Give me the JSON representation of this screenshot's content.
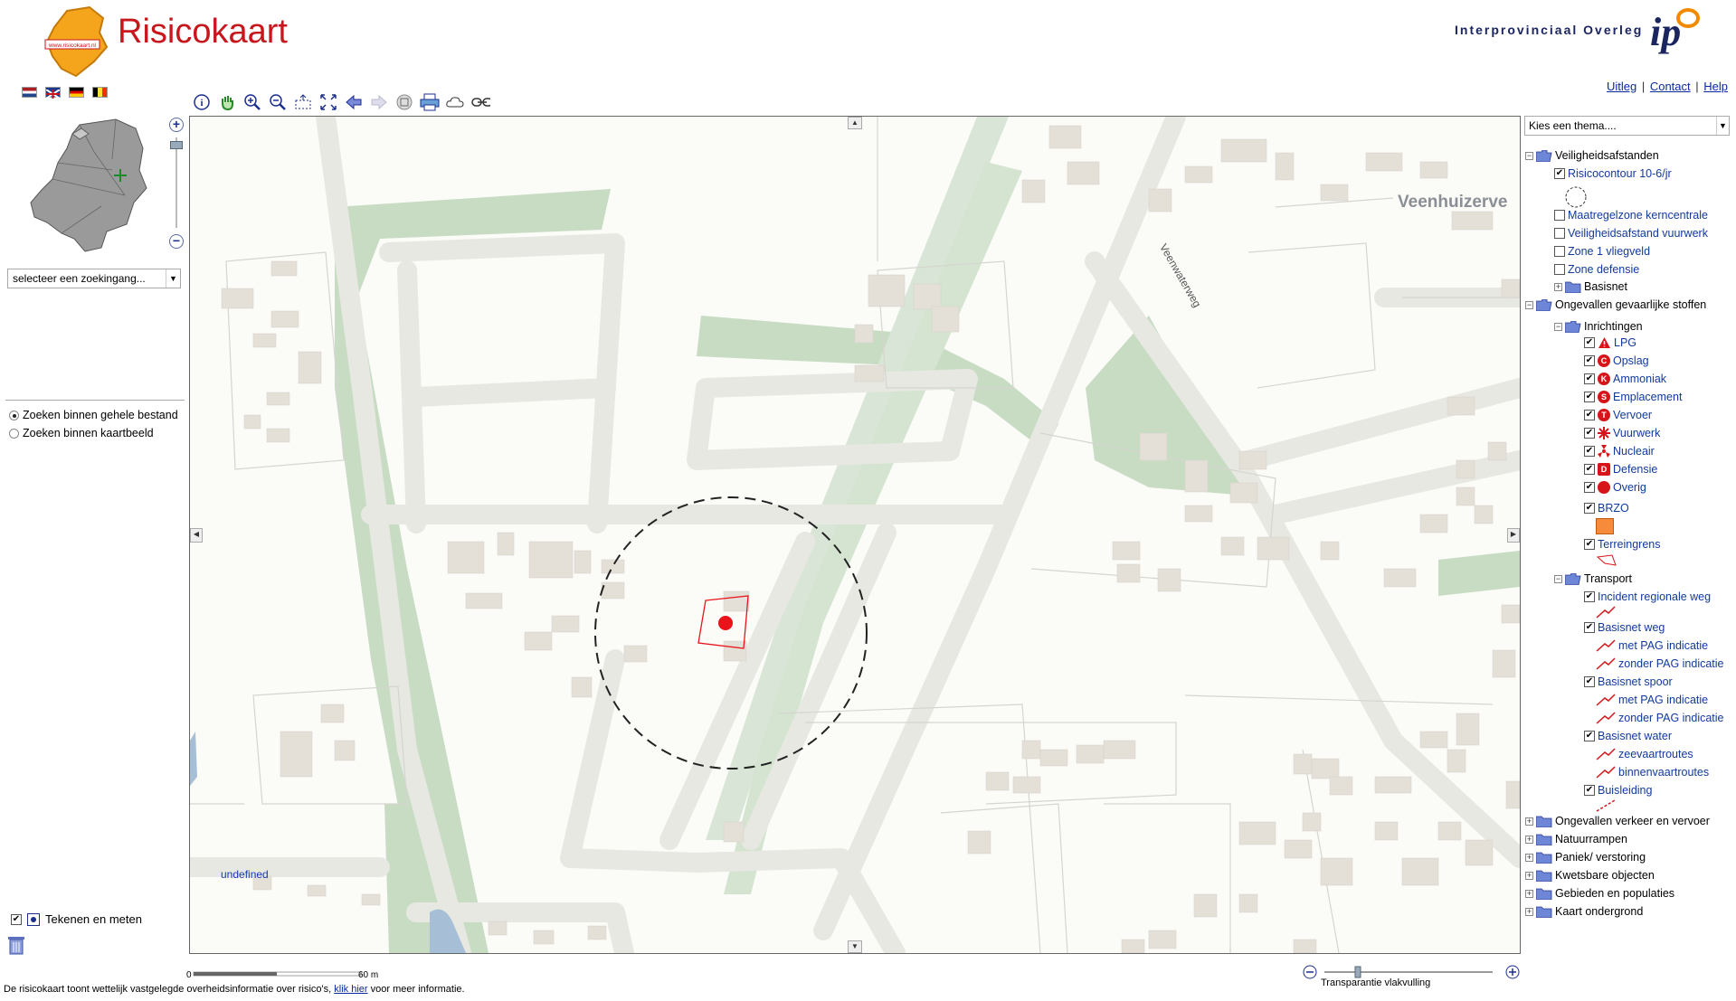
{
  "header": {
    "site_title": "Risicokaart",
    "logo_url_text": "www.risicokaart.nl",
    "partner_name": "Interprovinciaal Overleg",
    "partner_logo_text": "ip",
    "links": [
      {
        "label": "Uitleg"
      },
      {
        "label": "Contact"
      },
      {
        "label": "Help"
      }
    ]
  },
  "left_panel": {
    "search_select": "selecteer  een zoekingang...",
    "radio_options": [
      {
        "label": "Zoeken binnen gehele bestand",
        "selected": true
      },
      {
        "label": "Zoeken binnen kaartbeeld",
        "selected": false
      }
    ],
    "draw_measure_label": "Tekenen en meten"
  },
  "map": {
    "street_label": "Veenwaterweg",
    "place_label": "Veenhuizerve",
    "coord_readout": "undefined",
    "scale_start": "0",
    "scale_end": "60 m"
  },
  "transparency_label": "Transparantie vlakvulling",
  "footer": {
    "text_before": "De risicokaart toont wettelijk vastgelegde overheidsinformatie over risico's,",
    "link": "klik hier",
    "text_after": "voor meer informatie."
  },
  "right_panel": {
    "theme_select": "Kies een thema....",
    "colors": {
      "symbol_red": "#d7141a",
      "brzo_orange": "#f58b3b"
    },
    "tree": {
      "veiligheidsafstanden": "Veiligheidsafstanden",
      "risicocontour": "Risicocontour 10-6/jr",
      "maatregelzone": "Maatregelzone kerncentrale",
      "vuurwerk_afstand": "Veiligheidsafstand vuurwerk",
      "zone1": "Zone 1 vliegveld",
      "zone_defensie": "Zone defensie",
      "basisnet": "Basisnet",
      "ongevallen_stoffen": "Ongevallen gevaarlijke stoffen",
      "inrichtingen": "Inrichtingen",
      "lpg": "LPG",
      "opslag": "Opslag",
      "ammoniak": "Ammoniak",
      "emplacement": "Emplacement",
      "vervoer": "Vervoer",
      "vuurwerk": "Vuurwerk",
      "nucleair": "Nucleair",
      "defensie": "Defensie",
      "overig": "Overig",
      "brzo": "BRZO",
      "terreingrens": "Terreingrens",
      "transport": "Transport",
      "incident_weg": "Incident regionale weg",
      "basisnet_weg": "Basisnet weg",
      "met_pag_1": "met PAG indicatie",
      "zonder_pag_1": "zonder PAG indicatie",
      "basisnet_spoor": "Basisnet spoor",
      "met_pag_2": "met PAG indicatie",
      "zonder_pag_2": "zonder PAG indicatie",
      "basisnet_water": "Basisnet water",
      "zeevaartroutes": "zeevaartroutes",
      "binnenvaartroutes": "binnenvaartroutes",
      "buisleiding": "Buisleiding",
      "ongevallen_verkeer": "Ongevallen verkeer en vervoer",
      "natuurrampen": "Natuurrampen",
      "paniek": "Paniek/ verstoring",
      "kwetsbare": "Kwetsbare objecten",
      "gebieden": "Gebieden en populaties",
      "kaart_ondergrond": "Kaart ondergrond"
    }
  }
}
